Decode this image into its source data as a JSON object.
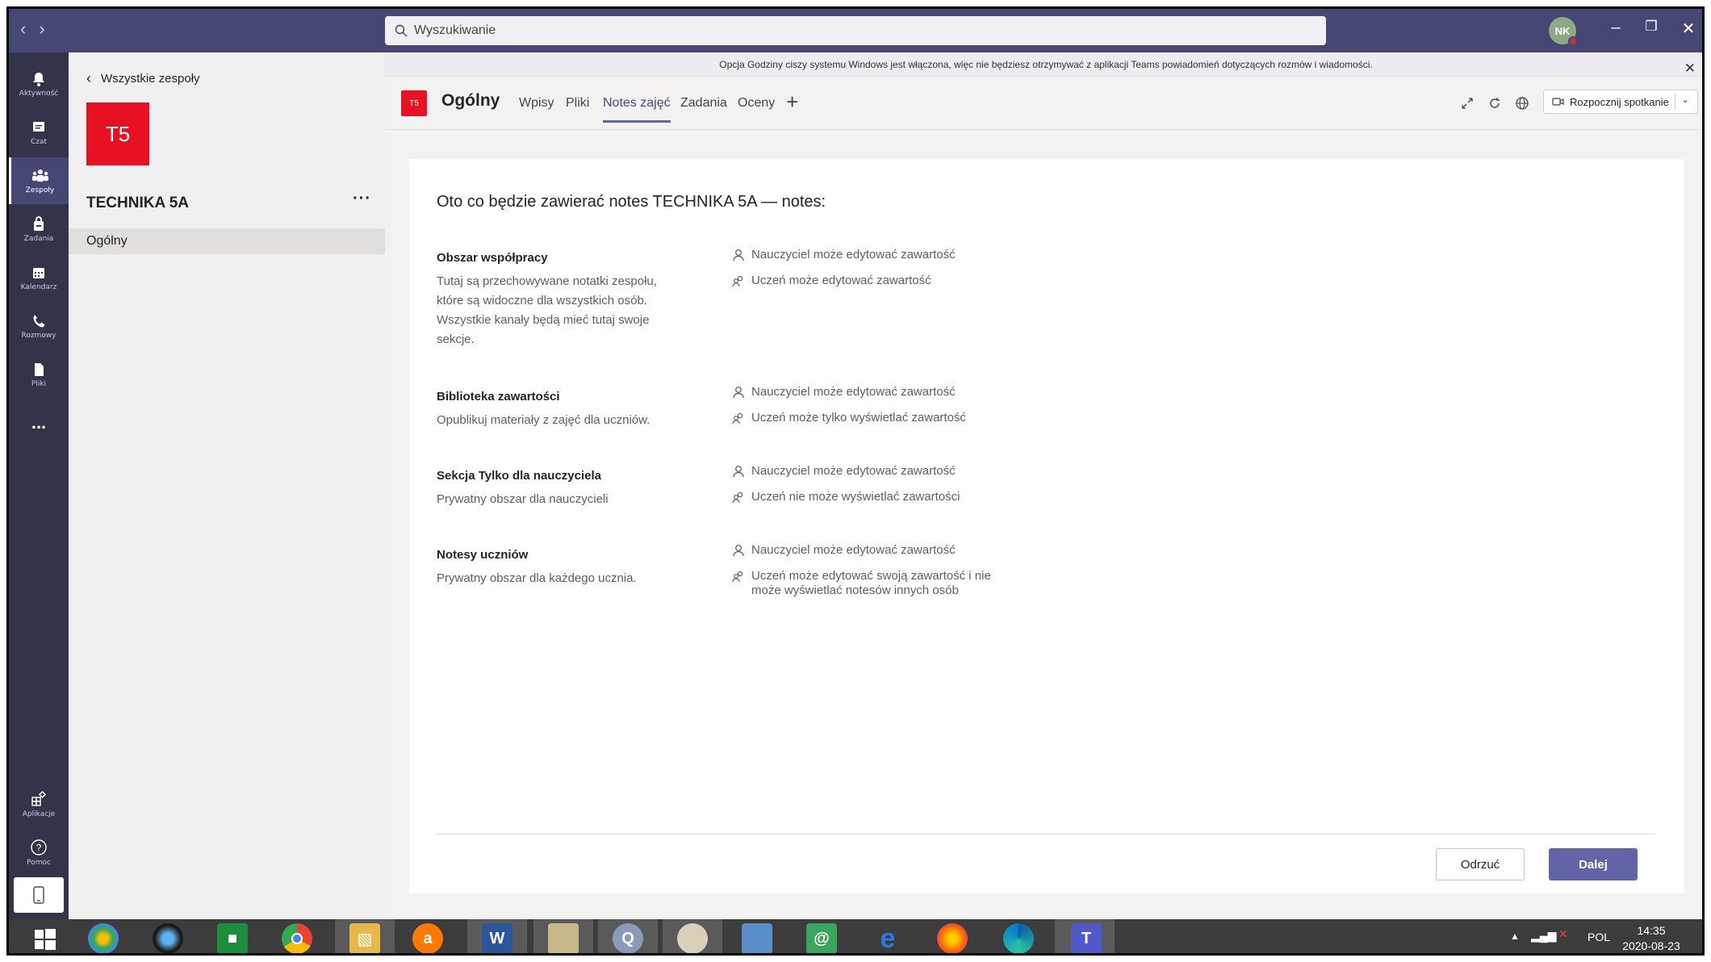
{
  "search": {
    "placeholder": "Wyszukiwanie"
  },
  "user": {
    "initials": "NK"
  },
  "rail": [
    {
      "label": "Aktywność",
      "icon": "bell-icon"
    },
    {
      "label": "Czat",
      "icon": "chat-icon"
    },
    {
      "label": "Zespoły",
      "icon": "teams-icon",
      "active": true
    },
    {
      "label": "Zadania",
      "icon": "assignments-icon"
    },
    {
      "label": "Kalendarz",
      "icon": "calendar-icon"
    },
    {
      "label": "Rozmowy",
      "icon": "phone-icon"
    },
    {
      "label": "Pliki",
      "icon": "files-icon"
    }
  ],
  "rail_more": "...",
  "rail_bottom": [
    {
      "label": "Aplikacje",
      "icon": "apps-icon"
    },
    {
      "label": "Pomoc",
      "icon": "help-icon"
    }
  ],
  "panel": {
    "back_label": "Wszystkie zespoły",
    "team_initials": "T5",
    "team_name": "TECHNIKA 5A",
    "more": "···",
    "channel": "Ogólny"
  },
  "banner": {
    "text": "Opcja Godziny ciszy systemu Windows jest włączona, więc nie będziesz otrzymywać z aplikacji Teams powiadomień dotyczących rozmów i wiadomości."
  },
  "channel_header": {
    "badge": "T5",
    "title": "Ogólny",
    "tabs": [
      "Wpisy",
      "Pliki",
      "Notes zajęć",
      "Zadania",
      "Oceny"
    ],
    "active_tab": "Notes zajęć",
    "meet_label": "Rozpocznij spotkanie"
  },
  "card": {
    "title": "Oto co będzie zawierać notes TECHNIKA 5A — notes:",
    "sections": [
      {
        "title": "Obszar współpracy",
        "desc": "Tutaj są przechowywane notatki zespołu, które są widoczne dla wszystkich osób. Wszystkie kanały będą mieć tutaj swoje sekcje.",
        "perms": [
          "Nauczyciel może edytować zawartość",
          "Uczeń może edytować zawartość"
        ]
      },
      {
        "title": "Biblioteka zawartości",
        "desc": "Opublikuj materiały z zajęć dla uczniów.",
        "perms": [
          "Nauczyciel może edytować zawartość",
          "Uczeń może tylko wyświetlać zawartość"
        ]
      },
      {
        "title": "Sekcja Tylko dla nauczyciela",
        "desc": "Prywatny obszar dla nauczycieli",
        "perms": [
          "Nauczyciel może edytować zawartość",
          "Uczeń nie może wyświetlać zawartości"
        ]
      },
      {
        "title": "Notesy uczniów",
        "desc": "Prywatny obszar dla każdego ucznia.",
        "perms": [
          "Nauczyciel może edytować zawartość",
          "Uczeń może edytować swoją zawartość i nie może wyświetlać notesów innych osób"
        ]
      }
    ],
    "discard_label": "Odrzuć",
    "next_label": "Dalej"
  },
  "taskbar": {
    "language": "POL",
    "time": "14:35",
    "date": "2020-08-23"
  },
  "colors": {
    "accent": "#6264a7",
    "titlebar": "#464775",
    "rail": "#33344a",
    "team": "#e81123"
  }
}
